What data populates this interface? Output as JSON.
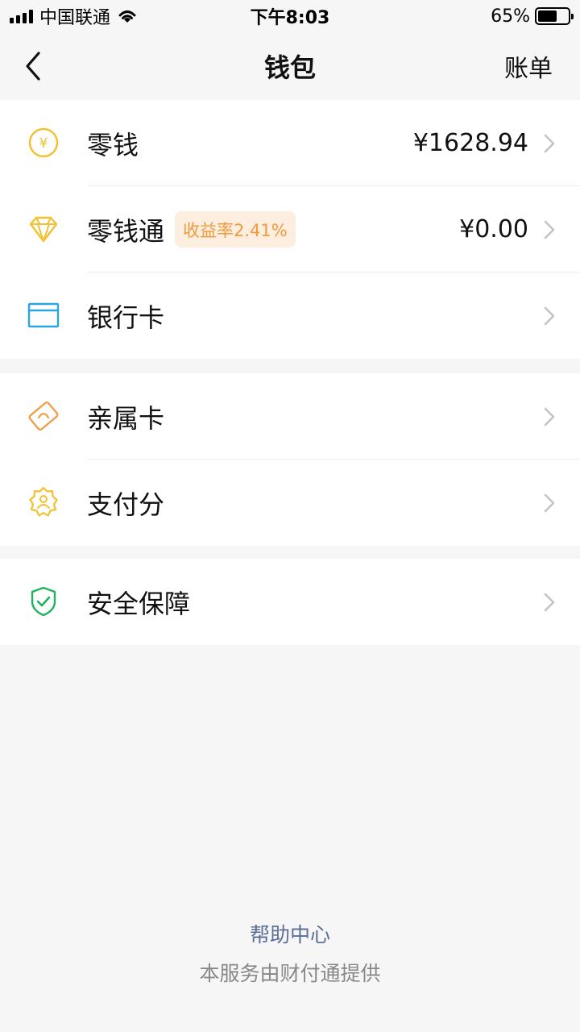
{
  "status_bar": {
    "carrier": "中国联通",
    "time": "下午8:03",
    "battery": "65%",
    "battery_level": 0.65
  },
  "nav": {
    "title": "钱包",
    "right_label": "账单"
  },
  "groups": [
    {
      "items": [
        {
          "label": "零钱",
          "value": "¥1628.94",
          "icon": "yen-coin-icon",
          "color": "#f3c12f"
        },
        {
          "label": "零钱通",
          "badge": "收益率2.41%",
          "value": "¥0.00",
          "icon": "diamond-icon",
          "color": "#f3c12f"
        },
        {
          "label": "银行卡",
          "icon": "bank-card-icon",
          "color": "#2aa5e2"
        }
      ]
    },
    {
      "items": [
        {
          "label": "亲属卡",
          "icon": "family-card-icon",
          "color": "#f0a04a"
        },
        {
          "label": "支付分",
          "icon": "payment-score-icon",
          "color": "#f3c12f"
        }
      ]
    },
    {
      "items": [
        {
          "label": "安全保障",
          "icon": "security-shield-icon",
          "color": "#1fb35f"
        }
      ]
    }
  ],
  "footer": {
    "help_link": "帮助中心",
    "note": "本服务由财付通提供"
  }
}
